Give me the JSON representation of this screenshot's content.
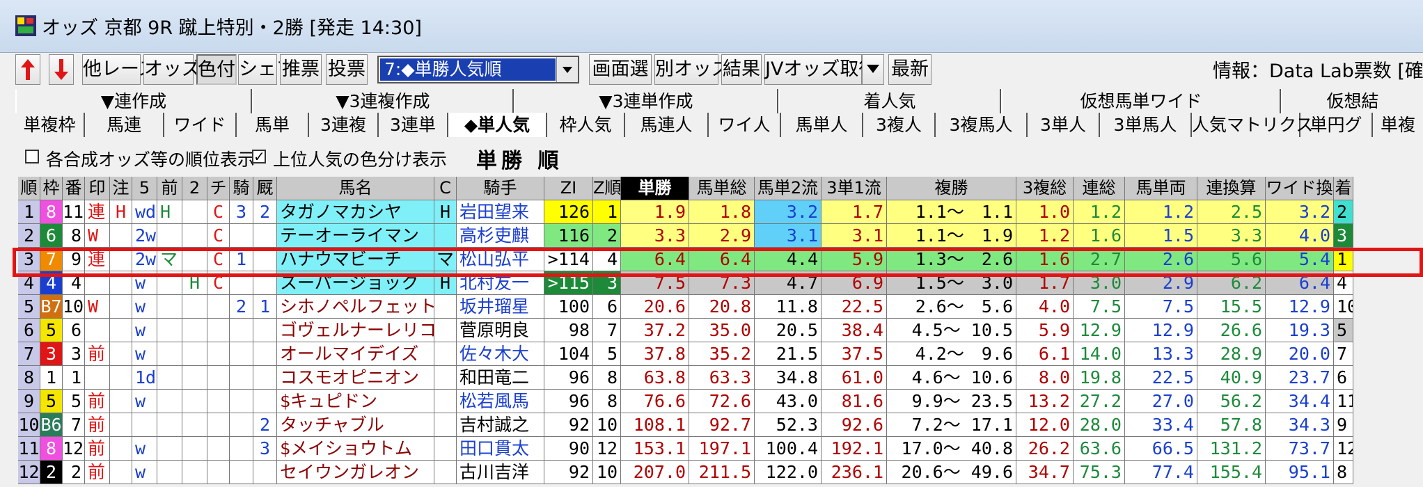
{
  "window": {
    "title": "オッズ 京都 9R 蹴上特別・2勝 [発走 14:30]"
  },
  "toolbar": {
    "buttons": [
      "他レース",
      "オッズ",
      "色付",
      "シェア",
      "推票",
      "投票",
      "画面選",
      "別オッズ",
      "結果",
      "JVオッズ取得",
      "最新"
    ],
    "combo_value": "7:◆単勝人気順",
    "info": "情報：Data Lab票数 [確定"
  },
  "tabs_top": [
    "▼連作成",
    "▼3連複作成",
    "▼3連単作成",
    "着人気",
    "仮想馬単ワイド",
    "仮想結"
  ],
  "tabs_bottom": [
    "単複枠",
    "馬連",
    "ワイド",
    "馬単",
    "3連複",
    "3連単",
    "◆単人気",
    "枠人気",
    "馬連人",
    "ワイ人",
    "馬単人",
    "3複人",
    "3複馬人",
    "3単人",
    "3単馬人",
    "人気マトリクス",
    "単円グ",
    "単複"
  ],
  "options": {
    "opt1": "各合成オッズ等の順位表示",
    "opt2": "上位人気の色分け表示",
    "opt2_check": "✓",
    "title": "単勝 順"
  },
  "table": {
    "headers": [
      "順",
      "枠",
      "番",
      "印",
      "注",
      "5",
      "前",
      "2",
      "チ",
      "騎",
      "厩",
      "馬名",
      "C",
      "騎手",
      "ZI",
      "Z順",
      "単勝",
      "馬単総",
      "馬単2流",
      "3単1流",
      "複勝",
      "3複総",
      "連総",
      "馬単両",
      "連換算",
      "ワイド換",
      "着"
    ],
    "rows": [
      [
        "1",
        "8",
        "11",
        "連",
        "H",
        "wd",
        "H",
        "",
        "C",
        "3",
        "2",
        "タガノマカシヤ",
        "H",
        "岩田望来",
        "126",
        "1",
        "1.9",
        "1.8",
        "3.2",
        "1.7",
        "1.1～　1.1",
        "1.0",
        "1.2",
        "1.2",
        "2.5",
        "3.2",
        "2"
      ],
      [
        "2",
        "6",
        "8",
        "W",
        "",
        "2w",
        "",
        "",
        "C",
        "",
        "",
        "テーオーライマン",
        "",
        "高杉吏麒",
        "116",
        "2",
        "3.3",
        "2.9",
        "3.1",
        "3.1",
        "1.1～　1.9",
        "1.2",
        "1.6",
        "1.5",
        "3.3",
        "4.0",
        "3"
      ],
      [
        "3",
        "7",
        "9",
        "連",
        "",
        "2w",
        "マ",
        "",
        "C",
        "1",
        "",
        "ハナウマビーチ",
        "マ",
        "松山弘平",
        ">114",
        "4",
        "6.4",
        "6.4",
        "4.4",
        "5.9",
        "1.3～　2.6",
        "1.6",
        "2.7",
        "2.6",
        "5.6",
        "5.4",
        "1"
      ],
      [
        "4",
        "4",
        "4",
        "",
        "",
        "w",
        "",
        "H",
        "C",
        "",
        "",
        "スーパージョック",
        "H",
        "北村友一",
        ">115",
        "3",
        "7.5",
        "7.3",
        "4.7",
        "6.9",
        "1.5～　3.0",
        "1.7",
        "3.0",
        "2.9",
        "6.2",
        "6.4",
        "4"
      ],
      [
        "5",
        "B7",
        "10",
        "W",
        "",
        "w",
        "",
        "",
        "",
        "2",
        "1",
        "シホノペルフェット",
        "",
        "坂井瑠星",
        "100",
        "6",
        "20.6",
        "20.8",
        "11.8",
        "22.5",
        "2.6～　5.6",
        "4.0",
        "7.5",
        "7.5",
        "15.5",
        "12.9",
        "10"
      ],
      [
        "6",
        "5",
        "6",
        "",
        "",
        "w",
        "",
        "",
        "",
        "",
        "",
        "ゴヴェルナーレリコ",
        "",
        "菅原明良",
        "98",
        "7",
        "37.2",
        "35.0",
        "20.5",
        "38.4",
        "4.5～ 10.5",
        "5.9",
        "12.9",
        "12.9",
        "26.6",
        "19.3",
        "5"
      ],
      [
        "7",
        "3",
        "3",
        "前",
        "",
        "w",
        "",
        "",
        "",
        "",
        "",
        "オールマイデイズ",
        "",
        "佐々木大",
        "104",
        "5",
        "37.8",
        "35.2",
        "21.5",
        "37.5",
        "4.2～　9.6",
        "6.1",
        "14.0",
        "13.3",
        "28.9",
        "20.0",
        "7"
      ],
      [
        "8",
        "1",
        "1",
        "",
        "",
        "1d",
        "",
        "",
        "",
        "",
        "",
        "コスモオピニオン",
        "",
        "和田竜二",
        "96",
        "8",
        "63.8",
        "63.3",
        "34.8",
        "61.0",
        "4.6～ 10.6",
        "8.0",
        "19.8",
        "22.5",
        "40.9",
        "23.7",
        "6"
      ],
      [
        "9",
        "5",
        "5",
        "前",
        "",
        "w",
        "",
        "",
        "",
        "",
        "",
        "$キュピドン",
        "",
        "松若風馬",
        "96",
        "8",
        "76.6",
        "72.6",
        "43.0",
        "81.6",
        "9.9～ 23.5",
        "13.2",
        "27.2",
        "27.0",
        "56.2",
        "34.4",
        "11"
      ],
      [
        "10",
        "B6",
        "7",
        "前",
        "",
        "",
        "",
        "",
        "",
        "",
        "2",
        "タッチャブル",
        "",
        "吉村誠之",
        "92",
        "10",
        "108.1",
        "92.7",
        "52.3",
        "92.6",
        "7.2～ 17.1",
        "12.0",
        "28.0",
        "33.4",
        "57.8",
        "34.3",
        "9"
      ],
      [
        "11",
        "8",
        "12",
        "前",
        "",
        "w",
        "",
        "",
        "",
        "",
        "3",
        "$メイショウトム",
        "",
        "田口貫太",
        "90",
        "12",
        "153.1",
        "197.1",
        "100.4",
        "192.1",
        "17.0～ 40.8",
        "26.2",
        "63.6",
        "66.5",
        "131.2",
        "73.7",
        "12"
      ],
      [
        "12",
        "2",
        "2",
        "前",
        "",
        "w",
        "",
        "",
        "",
        "",
        "",
        "セイウンガレオン",
        "",
        "古川吉洋",
        "92",
        "10",
        "207.0",
        "211.5",
        "122.0",
        "236.1",
        "20.6～ 49.6",
        "34.7",
        "75.3",
        "77.4",
        "155.4",
        "95.1",
        "8"
      ]
    ]
  },
  "colors": {
    "accent_red": "#e01515",
    "selection_blue": "#1a3fb0"
  }
}
